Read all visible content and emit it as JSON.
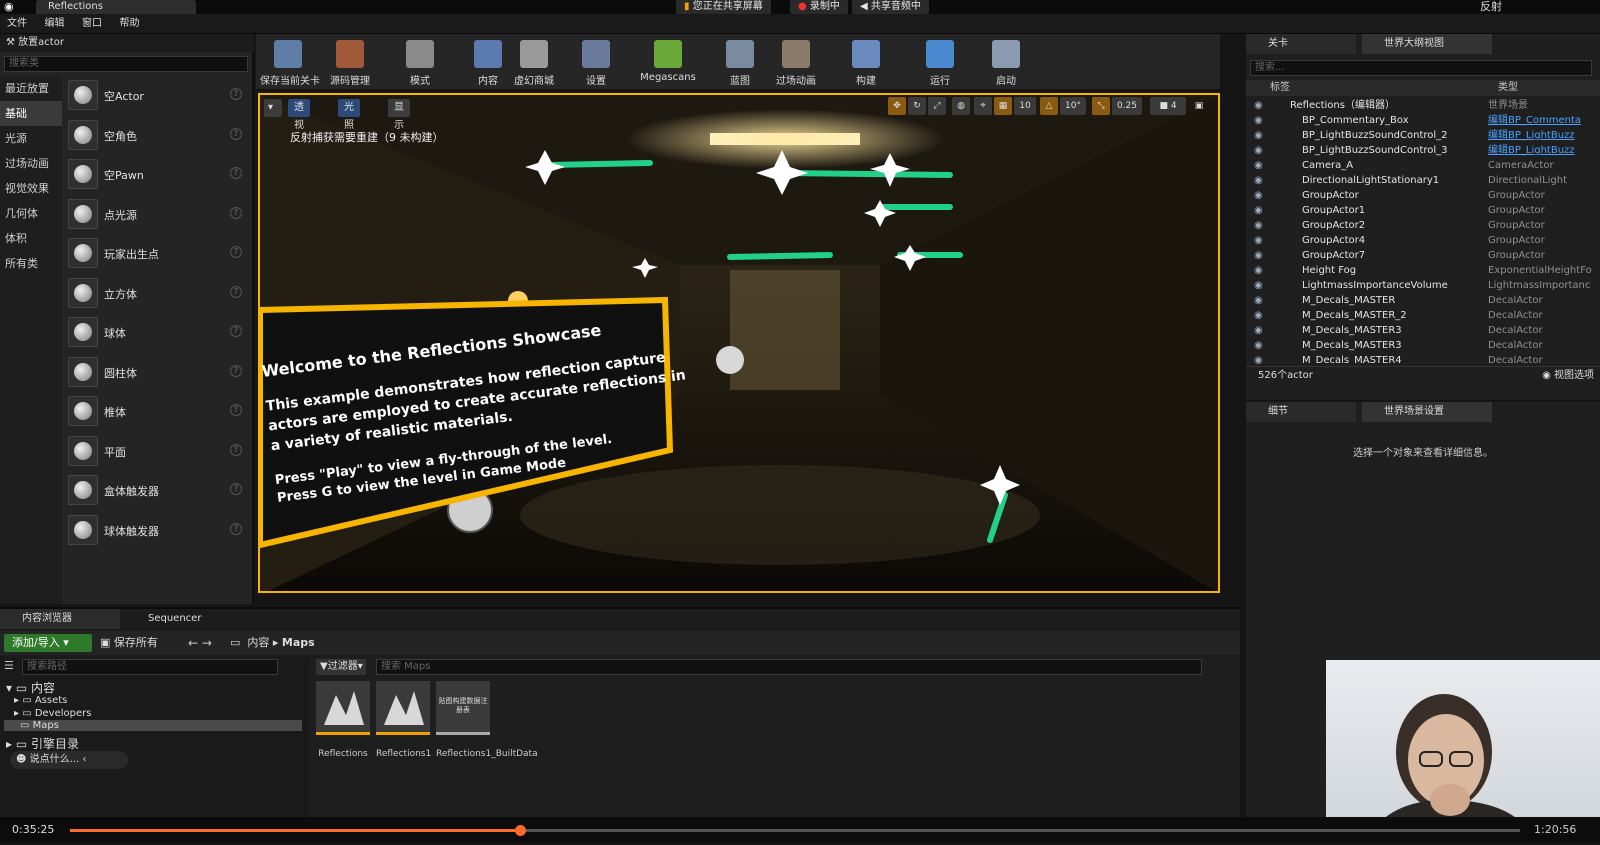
{
  "window": {
    "title": "Reflections",
    "share_status": "您正在共享屏幕",
    "recording": "录制中",
    "sharing_audio": "共享音频中",
    "right_label": "反射"
  },
  "menu": [
    "文件",
    "编辑",
    "窗口",
    "帮助"
  ],
  "place_actor": {
    "title": "放置actor",
    "search_placeholder": "搜索类",
    "categories": [
      "最近放置",
      "基础",
      "光源",
      "过场动画",
      "视觉效果",
      "几何体",
      "体积",
      "所有类"
    ],
    "selected_category": "基础",
    "items": [
      "空Actor",
      "空角色",
      "空Pawn",
      "点光源",
      "玩家出生点",
      "立方体",
      "球体",
      "圆柱体",
      "椎体",
      "平面",
      "盒体触发器",
      "球体触发器"
    ]
  },
  "toolbar": {
    "buttons": [
      "保存当前关卡",
      "源码管理",
      "模式",
      "内容",
      "虚幻商城",
      "设置",
      "Megascans",
      "蓝图",
      "过场动画",
      "构建",
      "运行",
      "启动"
    ]
  },
  "viewport": {
    "options": [
      "透视",
      "光照",
      "显示"
    ],
    "message": "反射捕获需要重建（9 未构建）",
    "grid_snap": "10",
    "rot_snap": "10°",
    "scale_snap": "0.25",
    "camera_speed": "4",
    "sign_lines": [
      "Welcome to the Reflections Showcase",
      "This example demonstrates how reflection capture",
      "actors are employed to create accurate reflections in",
      "a variety of realistic materials.",
      "Press \"Play\" to view a fly-through of the level.",
      "Press G to view the level in Game Mode"
    ]
  },
  "outliner": {
    "tabs": [
      "关卡",
      "世界大纲视图"
    ],
    "search_placeholder": "搜索...",
    "col_label": "标签",
    "col_type": "类型",
    "rows": [
      {
        "name": "Reflections（编辑器）",
        "type": "世界场景",
        "link": false
      },
      {
        "name": "BP_Commentary_Box",
        "type": "编辑BP_Commenta",
        "link": true
      },
      {
        "name": "BP_LightBuzzSoundControl_2",
        "type": "编辑BP_LightBuzz",
        "link": true
      },
      {
        "name": "BP_LightBuzzSoundControl_3",
        "type": "编辑BP_LightBuzz",
        "link": true
      },
      {
        "name": "Camera_A",
        "type": "CameraActor",
        "link": false
      },
      {
        "name": "DirectionalLightStationary1",
        "type": "DirectionalLight",
        "link": false
      },
      {
        "name": "GroupActor",
        "type": "GroupActor",
        "link": false
      },
      {
        "name": "GroupActor1",
        "type": "GroupActor",
        "link": false
      },
      {
        "name": "GroupActor2",
        "type": "GroupActor",
        "link": false
      },
      {
        "name": "GroupActor4",
        "type": "GroupActor",
        "link": false
      },
      {
        "name": "GroupActor7",
        "type": "GroupActor",
        "link": false
      },
      {
        "name": "Height Fog",
        "type": "ExponentialHeightFo",
        "link": false
      },
      {
        "name": "LightmassImportanceVolume",
        "type": "LightmassImportanc",
        "link": false
      },
      {
        "name": "M_Decals_MASTER",
        "type": "DecalActor",
        "link": false
      },
      {
        "name": "M_Decals_MASTER_2",
        "type": "DecalActor",
        "link": false
      },
      {
        "name": "M_Decals_MASTER3",
        "type": "DecalActor",
        "link": false
      },
      {
        "name": "M_Decals_MASTER3",
        "type": "DecalActor",
        "link": false
      },
      {
        "name": "M_Decals_MASTER4",
        "type": "DecalActor",
        "link": false
      }
    ],
    "count": "526个actor",
    "view_options": "视图选项"
  },
  "details": {
    "tabs": [
      "细节",
      "世界场景设置"
    ],
    "empty_message": "选择一个对象来查看详细信息。"
  },
  "content_browser": {
    "tabs": [
      "内容浏览器",
      "Sequencer"
    ],
    "add_import": "添加/导入",
    "save_all": "保存所有",
    "breadcrumb": [
      "内容",
      "Maps"
    ],
    "path_search_placeholder": "搜索路径",
    "filter": "过滤器",
    "asset_search_placeholder": "搜索 Maps",
    "tree": [
      "内容",
      "Assets",
      "Developers",
      "Maps",
      "引擎目录"
    ],
    "say_something": "说点什么...",
    "assets": [
      {
        "name": "Reflections",
        "thumb_text": ""
      },
      {
        "name": "Reflections1",
        "thumb_text": ""
      },
      {
        "name": "Reflections1_BuiltData",
        "thumb_text": "贴图构建数据注册表"
      }
    ]
  },
  "video": {
    "current_time": "0:35:25",
    "end_time": "1:20:56",
    "progress": 0.31
  }
}
